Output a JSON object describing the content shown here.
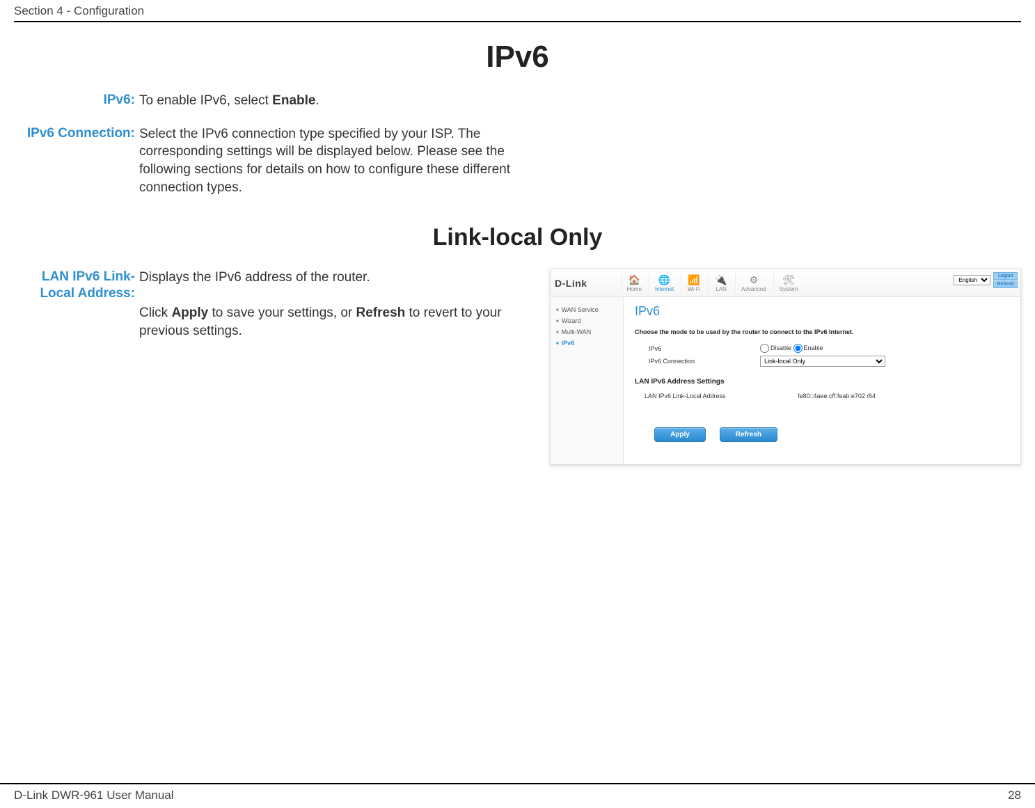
{
  "header": {
    "section": "Section 4 - Configuration"
  },
  "title1": "IPv6",
  "defs1": [
    {
      "term": "IPv6:",
      "desc_pre": "To enable IPv6, select ",
      "desc_bold": "Enable",
      "desc_post": "."
    },
    {
      "term": "IPv6 Connection:",
      "desc_pre": "Select the IPv6 connection type specified by your ISP. The corresponding settings will be displayed below. Please see the following sections for details on how to configure these different connection types.",
      "desc_bold": "",
      "desc_post": ""
    }
  ],
  "title2": "Link-local Only",
  "defs2": {
    "term": "LAN IPv6 Link-Local Address:",
    "desc": "Displays the IPv6 address of the router.",
    "note_pre": "Click ",
    "note_b1": "Apply",
    "note_mid": " to save your settings, or ",
    "note_b2": "Refresh",
    "note_post": " to revert to your previous settings."
  },
  "screenshot": {
    "logo": "D-Link",
    "nav": [
      {
        "label": "Home",
        "icon": "🏠",
        "active": false
      },
      {
        "label": "Internet",
        "icon": "🌐",
        "active": true
      },
      {
        "label": "Wi-Fi",
        "icon": "📶",
        "active": false
      },
      {
        "label": "LAN",
        "icon": "🔌",
        "active": false
      },
      {
        "label": "Advanced",
        "icon": "⚙",
        "active": false
      },
      {
        "label": "System",
        "icon": "🛠",
        "active": false
      }
    ],
    "lang": "English",
    "logout": "Logout",
    "refreshTop": "Refresh",
    "side": [
      {
        "label": "WAN Service",
        "active": false
      },
      {
        "label": "Wizard",
        "active": false
      },
      {
        "label": "Multi-WAN",
        "active": false
      },
      {
        "label": "IPv6",
        "active": true
      }
    ],
    "heading": "IPv6",
    "intro": "Choose the mode to be used by the router to connect to the IPv6 Internet.",
    "form": {
      "ipv6Label": "IPv6",
      "disable": "Disable",
      "enable": "Enable",
      "connLabel": "IPv6 Connection",
      "connValue": "Link-local Only"
    },
    "lanSection": "LAN IPv6 Address Settings",
    "lanRow": {
      "label": "LAN IPv6 Link-Local Address",
      "value": "fe80::4aee:cff:feab:e702 /64"
    },
    "buttons": {
      "apply": "Apply",
      "refresh": "Refresh"
    }
  },
  "footer": {
    "left": "D-Link DWR-961 User Manual",
    "right": "28"
  }
}
